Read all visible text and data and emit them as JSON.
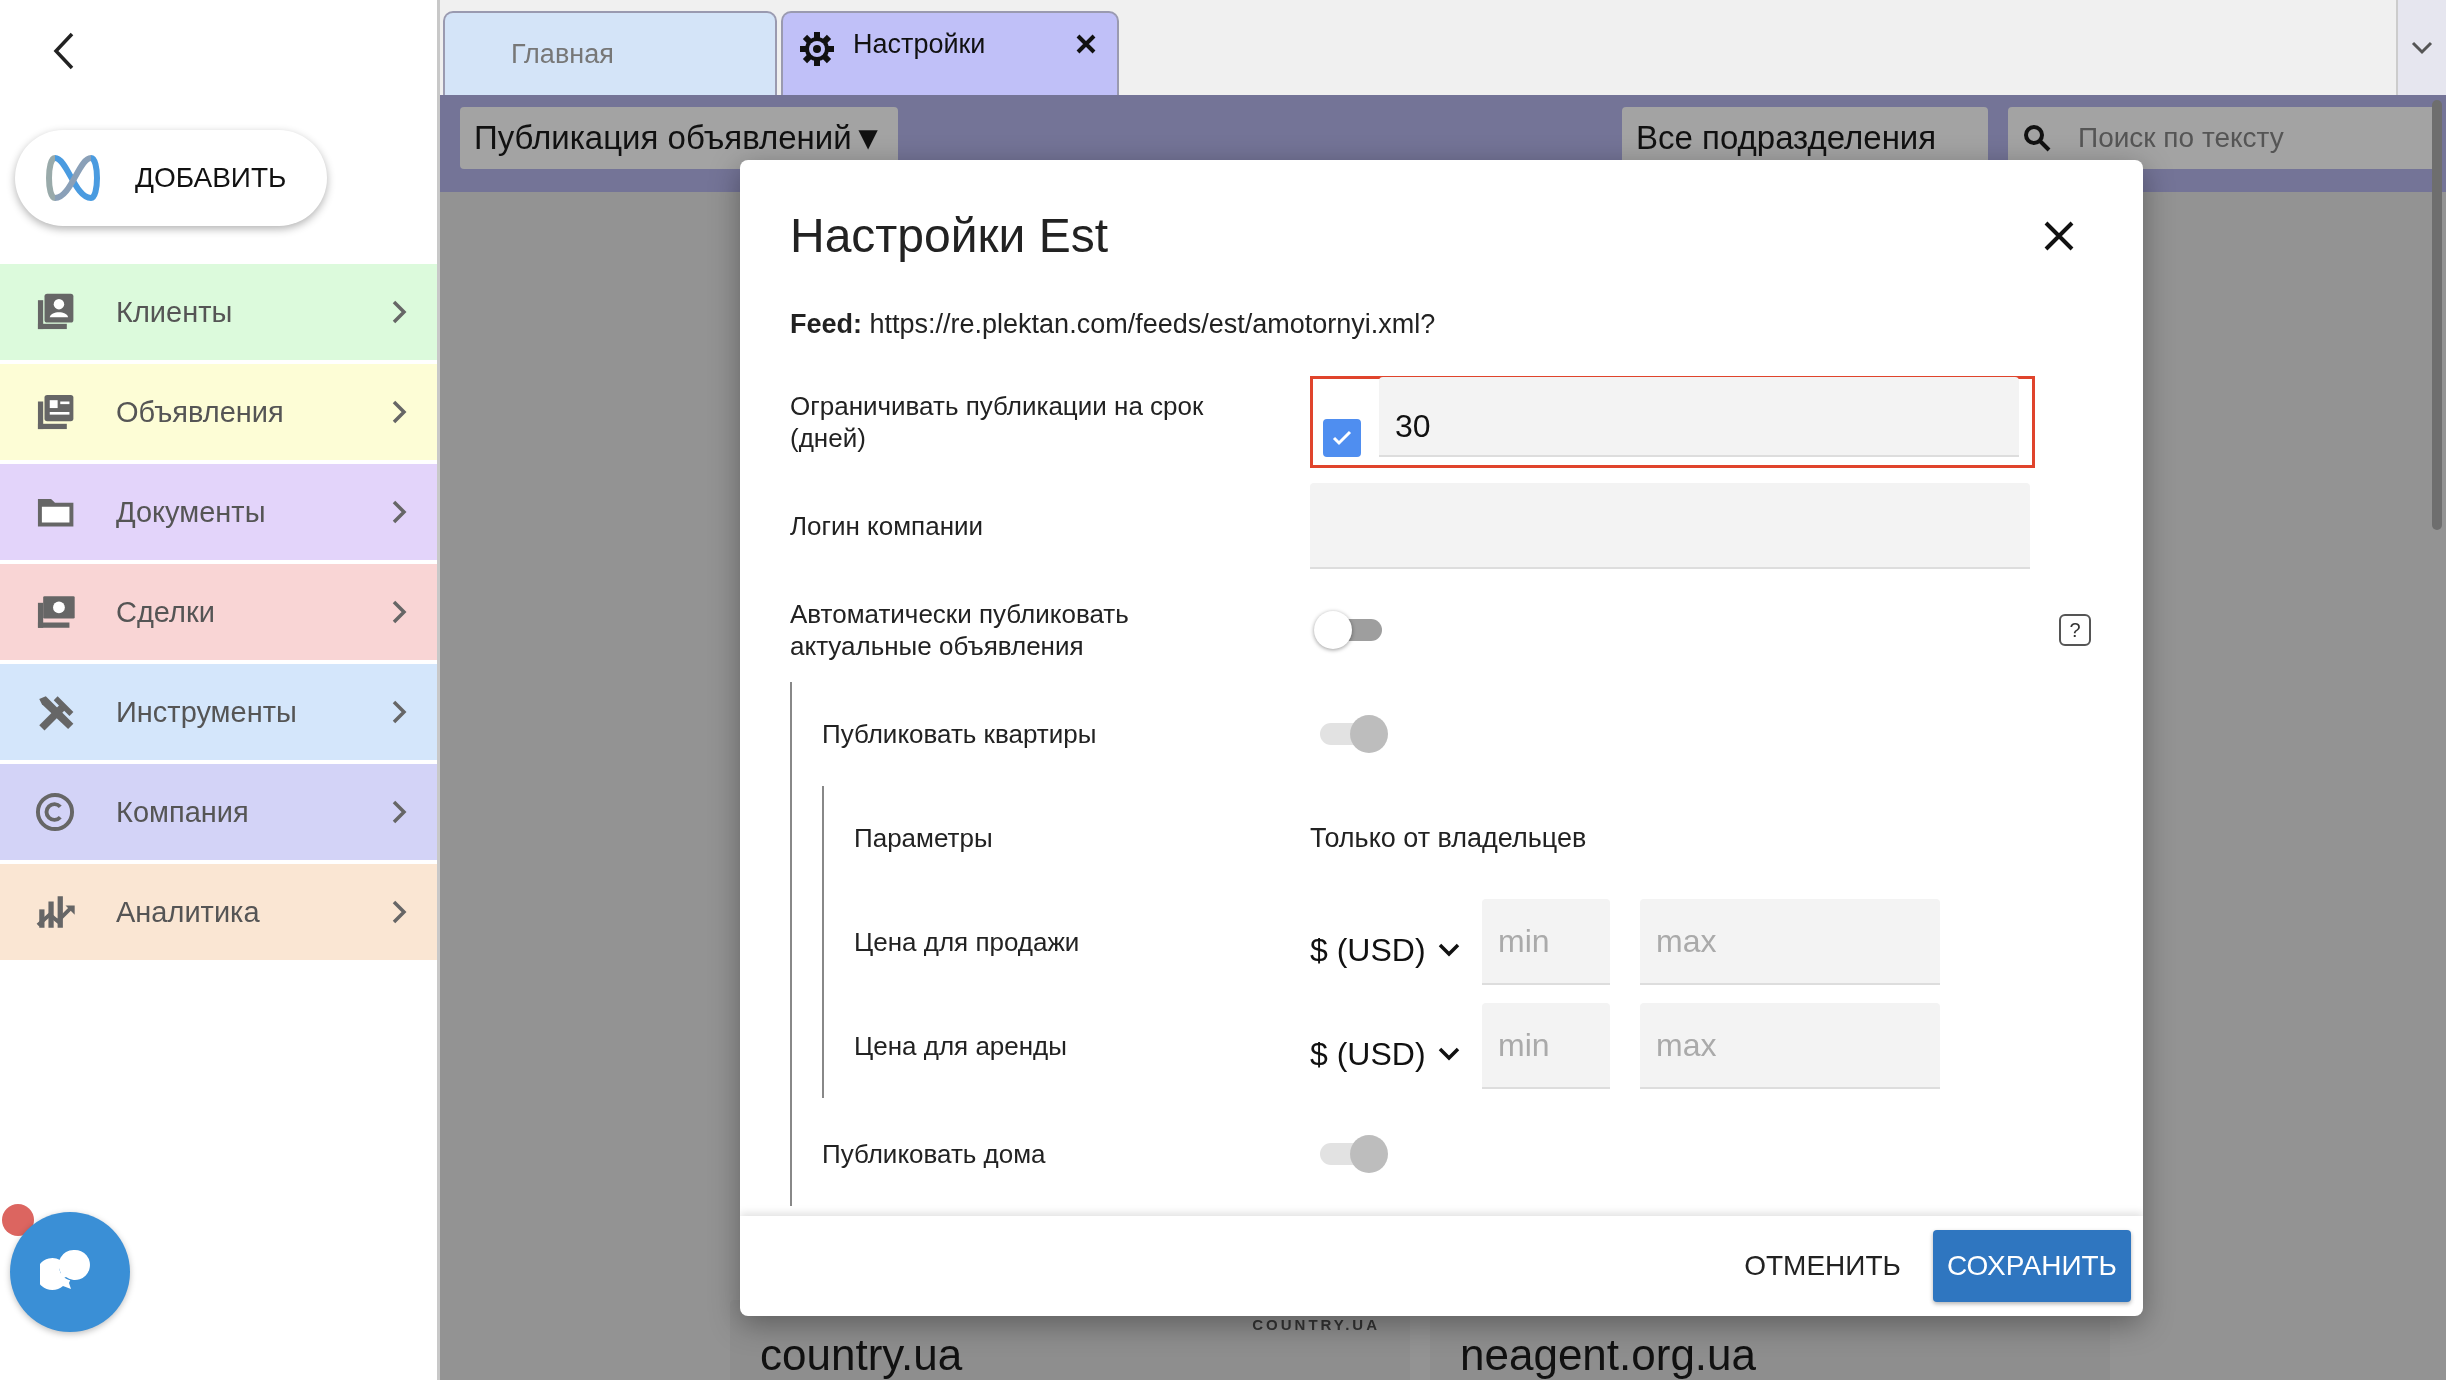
{
  "sidebar": {
    "add_button": "ДОБАВИТЬ",
    "items": [
      {
        "label": "Клиенты",
        "color": "#dcfadc"
      },
      {
        "label": "Объявления",
        "color": "#fdfdd6"
      },
      {
        "label": "Документы",
        "color": "#e3d4fa"
      },
      {
        "label": "Сделки",
        "color": "#f9d5d5"
      },
      {
        "label": "Инструменты",
        "color": "#d4e6fb"
      },
      {
        "label": "Компания",
        "color": "#d3d3f7"
      },
      {
        "label": "Аналитика",
        "color": "#fae6d3"
      }
    ]
  },
  "tabs": [
    {
      "label": "Главная",
      "selected": false,
      "closable": false
    },
    {
      "label": "Настройки",
      "selected": true,
      "closable": true
    }
  ],
  "toolbar": {
    "filter": {
      "label": "Публикация объявлений",
      "caret": "▼"
    },
    "department": "Все подразделения",
    "search": {
      "placeholder": "Поиск по тексту"
    }
  },
  "cards": [
    {
      "title": "country.ua",
      "logo": "COUNTRY.UA"
    },
    {
      "title": "neagent.org.ua"
    }
  ],
  "dialog": {
    "title": "Настройки Est",
    "feed": "**Feed:** https://re.plektan.com/feeds/est/amotornyi.xml?",
    "rows": [
      {
        "kind": "checkbox_input",
        "label": "Ограничивать публикации на срок (дней)",
        "checked": true,
        "value": "30",
        "highlighted": true
      },
      {
        "kind": "text_input",
        "label": "Логин компании"
      },
      {
        "kind": "toggle",
        "label": "Автоматически публиковать актуальные объявления",
        "on": false,
        "disabled": false,
        "help": "?",
        "children": [
          {
            "kind": "toggle",
            "label": "Публиковать квартиры",
            "on": true,
            "disabled": true,
            "children": [
              {
                "kind": "text",
                "label": "Параметры",
                "value": "Только от владельцев"
              },
              {
                "kind": "price",
                "label": "Цена для продажи",
                "currency": "$ (USD)",
                "min_placeholder": "min",
                "max_placeholder": "max"
              },
              {
                "kind": "price",
                "label": "Цена для аренды",
                "currency": "$ (USD)",
                "min_placeholder": "min",
                "max_placeholder": "max"
              }
            ]
          },
          {
            "kind": "toggle",
            "label": "Публиковать дома",
            "on": true,
            "disabled": true
          }
        ]
      }
    ],
    "buttons": [
      {
        "label": "ОТМЕНИТЬ",
        "kind": "text"
      },
      {
        "label": "СОХРАНИТЬ",
        "kind": "primary"
      }
    ]
  }
}
